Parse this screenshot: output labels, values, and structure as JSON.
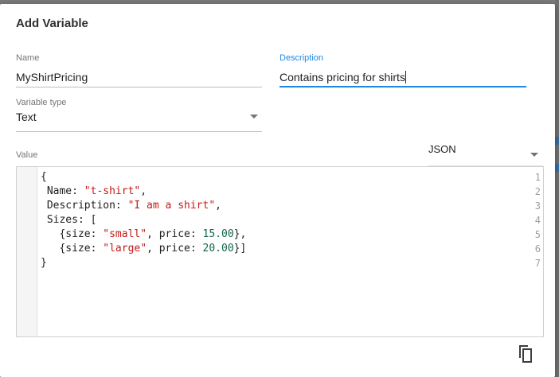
{
  "dialog": {
    "title": "Add Variable",
    "name_label": "Name",
    "name_value": "MyShirtPricing",
    "description_label": "Description",
    "description_value": "Contains pricing for shirts",
    "type_label": "Variable type",
    "type_value": "Text",
    "value_label": "Value",
    "format_value": "JSON"
  },
  "editor": {
    "lines": [
      {
        "num": "1",
        "tokens": [
          {
            "t": "{",
            "k": "plain"
          }
        ]
      },
      {
        "num": "2",
        "tokens": [
          {
            "t": " Name: ",
            "k": "plain"
          },
          {
            "t": "\"t-shirt\"",
            "k": "str"
          },
          {
            "t": ",",
            "k": "plain"
          }
        ]
      },
      {
        "num": "3",
        "tokens": [
          {
            "t": " Description: ",
            "k": "plain"
          },
          {
            "t": "\"I am a shirt\"",
            "k": "str"
          },
          {
            "t": ",",
            "k": "plain"
          }
        ]
      },
      {
        "num": "4",
        "tokens": [
          {
            "t": " Sizes: [",
            "k": "plain"
          }
        ]
      },
      {
        "num": "5",
        "tokens": [
          {
            "t": "   {size: ",
            "k": "plain"
          },
          {
            "t": "\"small\"",
            "k": "str"
          },
          {
            "t": ", price: ",
            "k": "plain"
          },
          {
            "t": "15.00",
            "k": "num"
          },
          {
            "t": "},",
            "k": "plain"
          }
        ]
      },
      {
        "num": "6",
        "tokens": [
          {
            "t": "   {size: ",
            "k": "plain"
          },
          {
            "t": "\"large\"",
            "k": "str"
          },
          {
            "t": ", price: ",
            "k": "plain"
          },
          {
            "t": "20.00",
            "k": "num"
          },
          {
            "t": "}]",
            "k": "plain"
          }
        ]
      },
      {
        "num": "7",
        "tokens": [
          {
            "t": "}",
            "k": "plain"
          }
        ]
      }
    ]
  },
  "icons": {
    "copy": "copy-icon",
    "dropdown": "chevron-down-icon"
  },
  "colors": {
    "accent": "#1e88e5",
    "string": "#c41a16",
    "number": "#116644"
  }
}
